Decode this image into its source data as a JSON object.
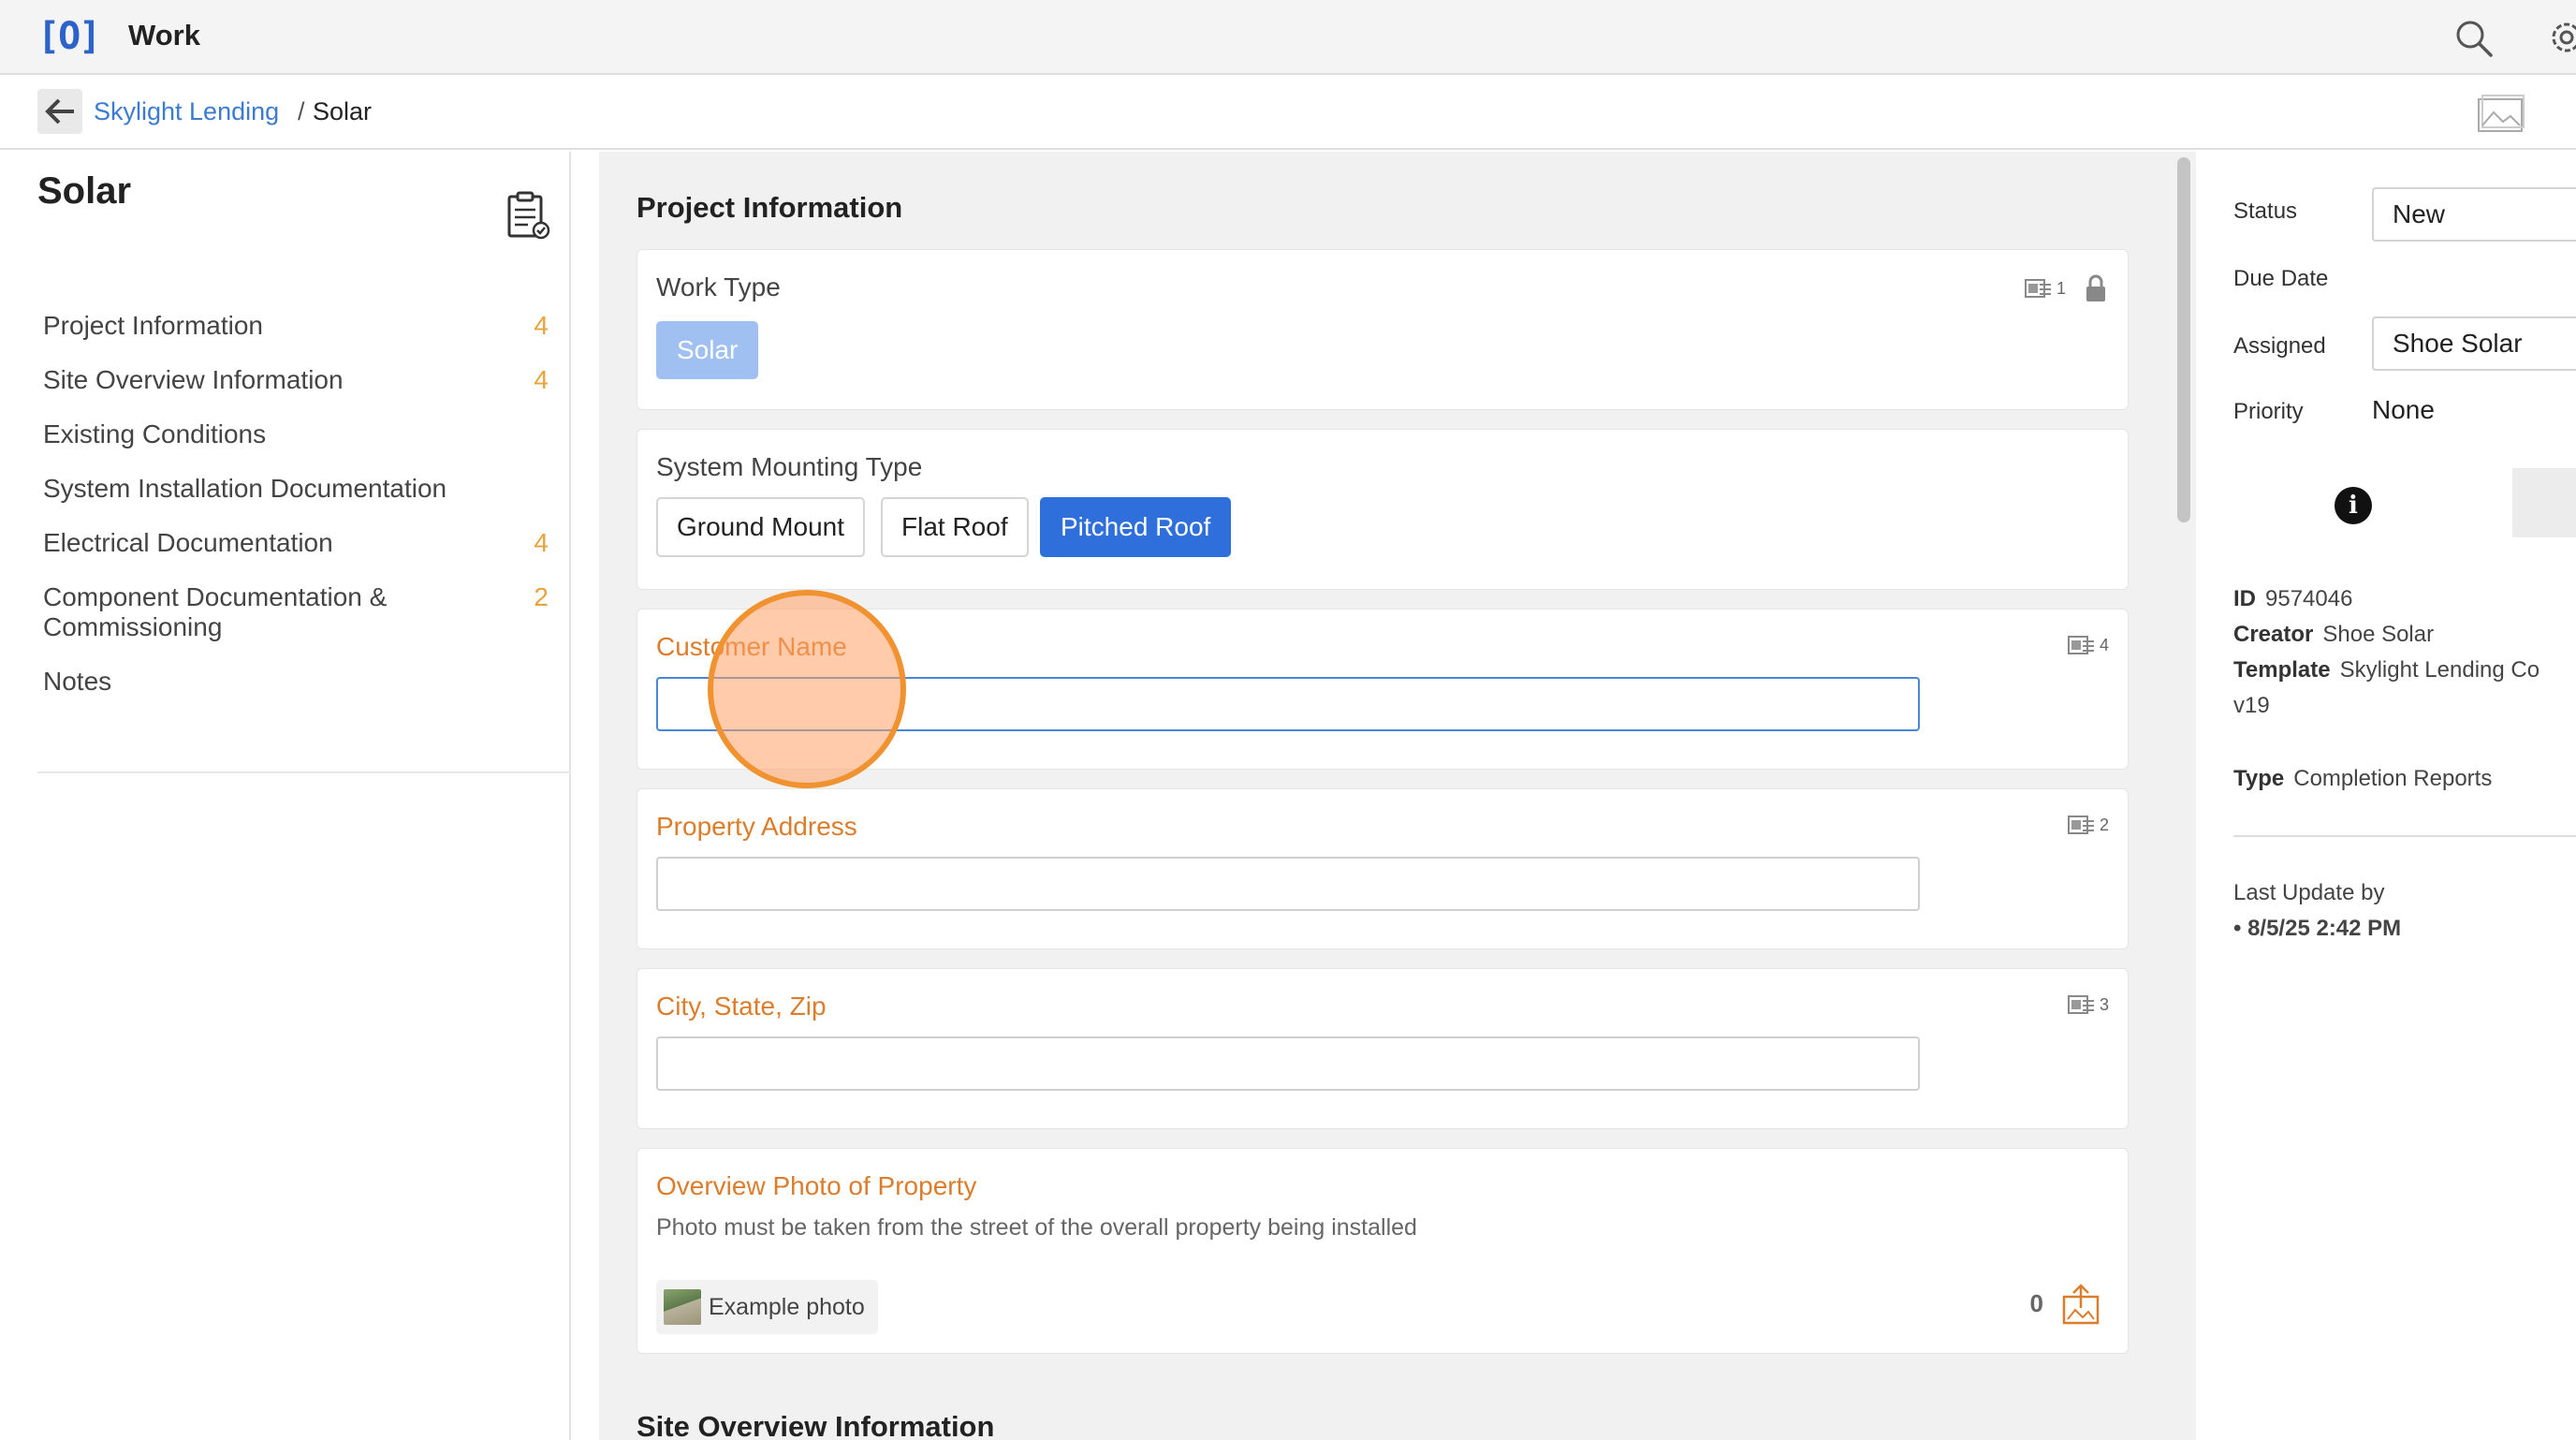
{
  "app": {
    "logo": "[O]",
    "title": "Work"
  },
  "breadcrumb": {
    "parent": "Skylight Lending",
    "separator": "/",
    "current": "Solar"
  },
  "sidebar": {
    "title": "Solar",
    "items": [
      {
        "label": "Project Information",
        "count": "4"
      },
      {
        "label": "Site Overview Information",
        "count": "4"
      },
      {
        "label": "Existing Conditions",
        "count": ""
      },
      {
        "label": "System Installation Documentation",
        "count": ""
      },
      {
        "label": "Electrical Documentation",
        "count": "4"
      },
      {
        "label": "Component Documentation & Commissioning",
        "count": "2"
      },
      {
        "label": "Notes",
        "count": ""
      }
    ]
  },
  "main": {
    "section_title": "Project Information",
    "next_section_title": "Site Overview Information",
    "work_type": {
      "label": "Work Type",
      "value": "Solar",
      "meta_count": "1"
    },
    "mounting": {
      "label": "System Mounting Type",
      "options": [
        "Ground Mount",
        "Flat Roof",
        "Pitched Roof"
      ],
      "selected": "Pitched Roof"
    },
    "customer_name": {
      "label": "Customer Name",
      "value": "",
      "meta_count": "4"
    },
    "property_address": {
      "label": "Property Address",
      "value": "",
      "meta_count": "2"
    },
    "city_state_zip": {
      "label": "City, State, Zip",
      "value": "",
      "meta_count": "3"
    },
    "overview_photo": {
      "label": "Overview Photo of Property",
      "description": "Photo must be taken from the street of the overall property being installed",
      "example_label": "Example photo",
      "count": "0"
    }
  },
  "details": {
    "status_label": "Status",
    "status_value": "New",
    "due_label": "Due Date",
    "assigned_label": "Assigned",
    "assigned_value": "Shoe Solar",
    "priority_label": "Priority",
    "priority_value": "None",
    "id_label": "ID",
    "id_value": "9574046",
    "creator_label": "Creator",
    "creator_value": "Shoe Solar",
    "template_label": "Template",
    "template_value": "Skylight Lending Co",
    "template_version": "v19",
    "type_label": "Type",
    "type_value": "Completion Reports",
    "last_update_label": "Last Update by",
    "last_update_value": "• 8/5/25 2:42 PM"
  },
  "colors": {
    "accent": "#2f6fdb",
    "warning": "#dc7d2c",
    "count": "#e8a33b",
    "chip": "#9fc0f1"
  }
}
